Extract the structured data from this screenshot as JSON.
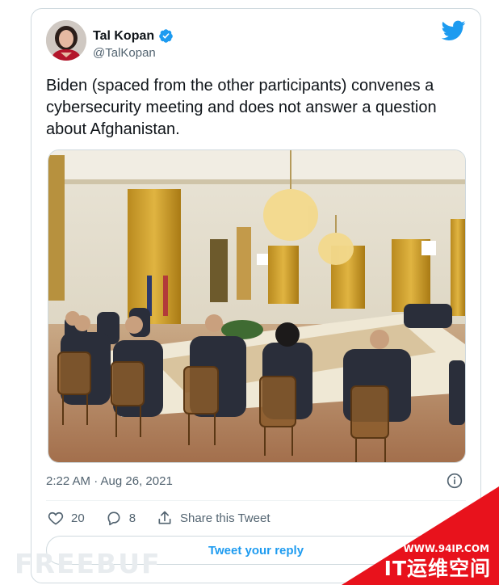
{
  "author": {
    "name": "Tal Kopan",
    "handle": "@TalKopan",
    "verified": true
  },
  "tweet": {
    "text": "Biden (spaced from the other participants) convenes a cybersecurity meeting and does not answer a question about Afghanistan.",
    "timestamp": "2:22 AM · Aug 26, 2021"
  },
  "actions": {
    "likes": "20",
    "replies": "8",
    "share_label": "Share this Tweet"
  },
  "reply_button_label": "Tweet your reply",
  "watermarks": {
    "left": "FREEBUF",
    "corner_url": "WWW.94IP.COM",
    "corner_title": "IT运维空间"
  },
  "colors": {
    "accent": "#1d9bf0",
    "text": "#0f1419",
    "secondary": "#536471",
    "watermark_red": "#e8121c"
  },
  "icons": [
    "twitter-bird-icon",
    "verified-badge-icon",
    "info-icon",
    "heart-icon",
    "reply-bubble-icon",
    "share-icon"
  ]
}
